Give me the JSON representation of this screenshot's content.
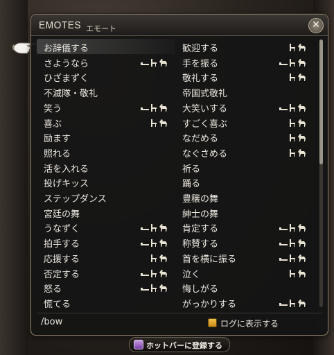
{
  "window": {
    "title_en": "EMOTES",
    "title_ja": "エモート",
    "close_glyph": "✕"
  },
  "emotes": [
    {
      "label": "お辞儀する",
      "icons": [],
      "selected": true
    },
    {
      "label": "歓迎する",
      "icons": [
        "chair",
        "horse"
      ]
    },
    {
      "label": "さようなら",
      "icons": [
        "bed",
        "chair",
        "horse"
      ]
    },
    {
      "label": "手を振る",
      "icons": [
        "bed",
        "chair",
        "horse"
      ]
    },
    {
      "label": "ひざまずく",
      "icons": []
    },
    {
      "label": "敬礼する",
      "icons": [
        "chair",
        "horse"
      ]
    },
    {
      "label": "不滅隊・敬礼",
      "icons": []
    },
    {
      "label": "帝国式敬礼",
      "icons": []
    },
    {
      "label": "笑う",
      "icons": [
        "bed",
        "chair",
        "horse"
      ]
    },
    {
      "label": "大笑いする",
      "icons": [
        "bed",
        "chair",
        "horse"
      ]
    },
    {
      "label": "喜ぶ",
      "icons": [
        "chair",
        "horse"
      ]
    },
    {
      "label": "すごく喜ぶ",
      "icons": [
        "chair",
        "horse"
      ]
    },
    {
      "label": "励ます",
      "icons": []
    },
    {
      "label": "なだめる",
      "icons": [
        "chair",
        "horse"
      ]
    },
    {
      "label": "照れる",
      "icons": []
    },
    {
      "label": "なぐさめる",
      "icons": [
        "chair",
        "horse"
      ]
    },
    {
      "label": "活を入れる",
      "icons": []
    },
    {
      "label": "祈る",
      "icons": []
    },
    {
      "label": "投げキッス",
      "icons": []
    },
    {
      "label": "踊る",
      "icons": []
    },
    {
      "label": "ステップダンス",
      "icons": []
    },
    {
      "label": "豊穣の舞",
      "icons": []
    },
    {
      "label": "宮廷の舞",
      "icons": []
    },
    {
      "label": "紳士の舞",
      "icons": []
    },
    {
      "label": "うなずく",
      "icons": [
        "bed",
        "chair",
        "horse"
      ]
    },
    {
      "label": "肯定する",
      "icons": [
        "bed",
        "chair",
        "horse"
      ]
    },
    {
      "label": "拍手する",
      "icons": [
        "bed",
        "chair",
        "horse"
      ]
    },
    {
      "label": "称賛する",
      "icons": [
        "bed",
        "chair",
        "horse"
      ]
    },
    {
      "label": "応援する",
      "icons": [
        "chair",
        "horse"
      ]
    },
    {
      "label": "首を横に振る",
      "icons": [
        "bed",
        "chair",
        "horse"
      ]
    },
    {
      "label": "否定する",
      "icons": [
        "bed",
        "chair",
        "horse"
      ]
    },
    {
      "label": "泣く",
      "icons": [
        "chair",
        "horse"
      ]
    },
    {
      "label": "怒る",
      "icons": [
        "bed",
        "chair",
        "horse"
      ]
    },
    {
      "label": "悔しがる",
      "icons": []
    },
    {
      "label": "慌てる",
      "icons": []
    },
    {
      "label": "がっかりする",
      "icons": [
        "bed",
        "chair",
        "horse"
      ]
    }
  ],
  "footer": {
    "command": "/bow",
    "log_label": "ログに表示する",
    "log_checked": true
  },
  "hotbar_button": {
    "label": "ホットバーに登録する"
  },
  "colors": {
    "accent": "#e3a82a",
    "text": "#ece8e0"
  }
}
